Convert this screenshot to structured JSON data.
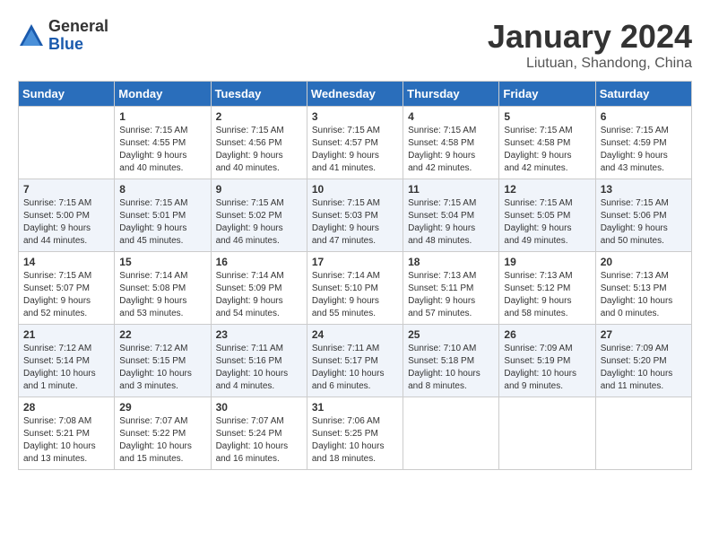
{
  "logo": {
    "general": "General",
    "blue": "Blue"
  },
  "title": "January 2024",
  "subtitle": "Liutuan, Shandong, China",
  "days_header": [
    "Sunday",
    "Monday",
    "Tuesday",
    "Wednesday",
    "Thursday",
    "Friday",
    "Saturday"
  ],
  "weeks": [
    [
      {
        "day": "",
        "content": ""
      },
      {
        "day": "1",
        "content": "Sunrise: 7:15 AM\nSunset: 4:55 PM\nDaylight: 9 hours\nand 40 minutes."
      },
      {
        "day": "2",
        "content": "Sunrise: 7:15 AM\nSunset: 4:56 PM\nDaylight: 9 hours\nand 40 minutes."
      },
      {
        "day": "3",
        "content": "Sunrise: 7:15 AM\nSunset: 4:57 PM\nDaylight: 9 hours\nand 41 minutes."
      },
      {
        "day": "4",
        "content": "Sunrise: 7:15 AM\nSunset: 4:58 PM\nDaylight: 9 hours\nand 42 minutes."
      },
      {
        "day": "5",
        "content": "Sunrise: 7:15 AM\nSunset: 4:58 PM\nDaylight: 9 hours\nand 42 minutes."
      },
      {
        "day": "6",
        "content": "Sunrise: 7:15 AM\nSunset: 4:59 PM\nDaylight: 9 hours\nand 43 minutes."
      }
    ],
    [
      {
        "day": "7",
        "content": "Sunrise: 7:15 AM\nSunset: 5:00 PM\nDaylight: 9 hours\nand 44 minutes."
      },
      {
        "day": "8",
        "content": "Sunrise: 7:15 AM\nSunset: 5:01 PM\nDaylight: 9 hours\nand 45 minutes."
      },
      {
        "day": "9",
        "content": "Sunrise: 7:15 AM\nSunset: 5:02 PM\nDaylight: 9 hours\nand 46 minutes."
      },
      {
        "day": "10",
        "content": "Sunrise: 7:15 AM\nSunset: 5:03 PM\nDaylight: 9 hours\nand 47 minutes."
      },
      {
        "day": "11",
        "content": "Sunrise: 7:15 AM\nSunset: 5:04 PM\nDaylight: 9 hours\nand 48 minutes."
      },
      {
        "day": "12",
        "content": "Sunrise: 7:15 AM\nSunset: 5:05 PM\nDaylight: 9 hours\nand 49 minutes."
      },
      {
        "day": "13",
        "content": "Sunrise: 7:15 AM\nSunset: 5:06 PM\nDaylight: 9 hours\nand 50 minutes."
      }
    ],
    [
      {
        "day": "14",
        "content": "Sunrise: 7:15 AM\nSunset: 5:07 PM\nDaylight: 9 hours\nand 52 minutes."
      },
      {
        "day": "15",
        "content": "Sunrise: 7:14 AM\nSunset: 5:08 PM\nDaylight: 9 hours\nand 53 minutes."
      },
      {
        "day": "16",
        "content": "Sunrise: 7:14 AM\nSunset: 5:09 PM\nDaylight: 9 hours\nand 54 minutes."
      },
      {
        "day": "17",
        "content": "Sunrise: 7:14 AM\nSunset: 5:10 PM\nDaylight: 9 hours\nand 55 minutes."
      },
      {
        "day": "18",
        "content": "Sunrise: 7:13 AM\nSunset: 5:11 PM\nDaylight: 9 hours\nand 57 minutes."
      },
      {
        "day": "19",
        "content": "Sunrise: 7:13 AM\nSunset: 5:12 PM\nDaylight: 9 hours\nand 58 minutes."
      },
      {
        "day": "20",
        "content": "Sunrise: 7:13 AM\nSunset: 5:13 PM\nDaylight: 10 hours\nand 0 minutes."
      }
    ],
    [
      {
        "day": "21",
        "content": "Sunrise: 7:12 AM\nSunset: 5:14 PM\nDaylight: 10 hours\nand 1 minute."
      },
      {
        "day": "22",
        "content": "Sunrise: 7:12 AM\nSunset: 5:15 PM\nDaylight: 10 hours\nand 3 minutes."
      },
      {
        "day": "23",
        "content": "Sunrise: 7:11 AM\nSunset: 5:16 PM\nDaylight: 10 hours\nand 4 minutes."
      },
      {
        "day": "24",
        "content": "Sunrise: 7:11 AM\nSunset: 5:17 PM\nDaylight: 10 hours\nand 6 minutes."
      },
      {
        "day": "25",
        "content": "Sunrise: 7:10 AM\nSunset: 5:18 PM\nDaylight: 10 hours\nand 8 minutes."
      },
      {
        "day": "26",
        "content": "Sunrise: 7:09 AM\nSunset: 5:19 PM\nDaylight: 10 hours\nand 9 minutes."
      },
      {
        "day": "27",
        "content": "Sunrise: 7:09 AM\nSunset: 5:20 PM\nDaylight: 10 hours\nand 11 minutes."
      }
    ],
    [
      {
        "day": "28",
        "content": "Sunrise: 7:08 AM\nSunset: 5:21 PM\nDaylight: 10 hours\nand 13 minutes."
      },
      {
        "day": "29",
        "content": "Sunrise: 7:07 AM\nSunset: 5:22 PM\nDaylight: 10 hours\nand 15 minutes."
      },
      {
        "day": "30",
        "content": "Sunrise: 7:07 AM\nSunset: 5:24 PM\nDaylight: 10 hours\nand 16 minutes."
      },
      {
        "day": "31",
        "content": "Sunrise: 7:06 AM\nSunset: 5:25 PM\nDaylight: 10 hours\nand 18 minutes."
      },
      {
        "day": "",
        "content": ""
      },
      {
        "day": "",
        "content": ""
      },
      {
        "day": "",
        "content": ""
      }
    ]
  ]
}
